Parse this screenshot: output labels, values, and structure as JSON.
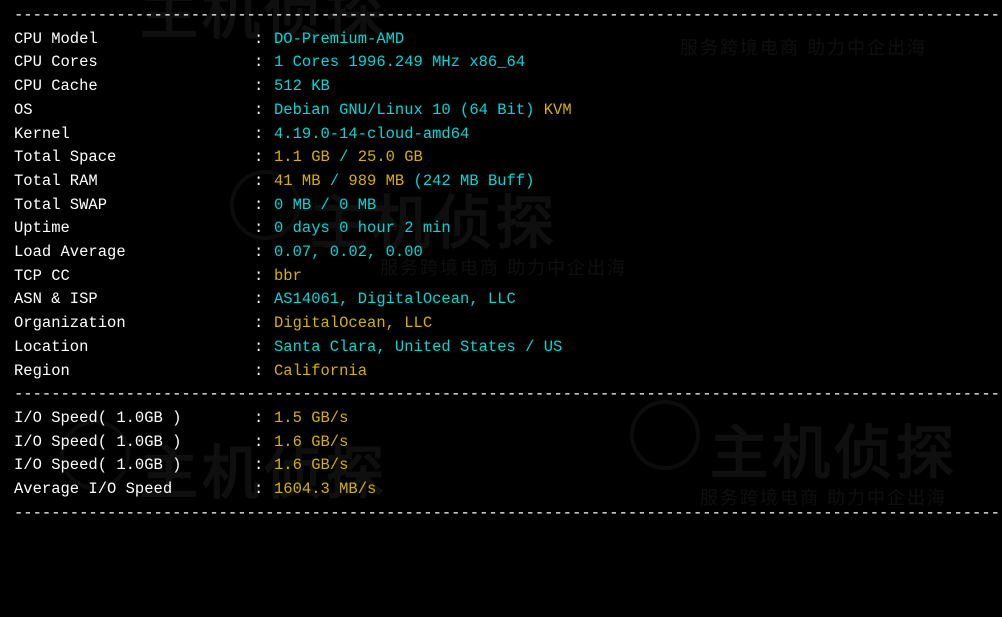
{
  "separator": "----------------------------------------------------------------------------------------------------------",
  "sys": [
    {
      "label": "CPU Model          ",
      "parts": [
        {
          "c": "cyan",
          "t": "DO-Premium-AMD"
        }
      ]
    },
    {
      "label": "CPU Cores          ",
      "parts": [
        {
          "c": "cyan",
          "t": "1 Cores 1996.249 MHz x86_64"
        }
      ]
    },
    {
      "label": "CPU Cache          ",
      "parts": [
        {
          "c": "cyan",
          "t": "512 KB"
        }
      ]
    },
    {
      "label": "OS                 ",
      "parts": [
        {
          "c": "cyan",
          "t": "Debian GNU/Linux 10 (64 Bit) "
        },
        {
          "c": "yellow",
          "t": "KVM"
        }
      ]
    },
    {
      "label": "Kernel             ",
      "parts": [
        {
          "c": "cyan",
          "t": "4.19.0-14-cloud-amd64"
        }
      ]
    },
    {
      "label": "Total Space        ",
      "parts": [
        {
          "c": "yellow",
          "t": "1.1 GB "
        },
        {
          "c": "cyan",
          "t": "/ "
        },
        {
          "c": "yellow",
          "t": "25.0 GB"
        }
      ]
    },
    {
      "label": "Total RAM          ",
      "parts": [
        {
          "c": "yellow",
          "t": "41 MB "
        },
        {
          "c": "cyan",
          "t": "/ "
        },
        {
          "c": "yellow",
          "t": "989 MB "
        },
        {
          "c": "cyan",
          "t": "(242 MB Buff)"
        }
      ]
    },
    {
      "label": "Total SWAP         ",
      "parts": [
        {
          "c": "cyan",
          "t": "0 MB / 0 MB"
        }
      ]
    },
    {
      "label": "Uptime             ",
      "parts": [
        {
          "c": "cyan",
          "t": "0 days 0 hour 2 min"
        }
      ]
    },
    {
      "label": "Load Average       ",
      "parts": [
        {
          "c": "cyan",
          "t": "0.07, 0.02, 0.00"
        }
      ]
    },
    {
      "label": "TCP CC             ",
      "parts": [
        {
          "c": "yellow",
          "t": "bbr"
        }
      ]
    },
    {
      "label": "ASN & ISP          ",
      "parts": [
        {
          "c": "cyan",
          "t": "AS14061, DigitalOcean, LLC"
        }
      ]
    },
    {
      "label": "Organization       ",
      "parts": [
        {
          "c": "yellow",
          "t": "DigitalOcean, LLC"
        }
      ]
    },
    {
      "label": "Location           ",
      "parts": [
        {
          "c": "cyan",
          "t": "Santa Clara, United States / US"
        }
      ]
    },
    {
      "label": "Region             ",
      "parts": [
        {
          "c": "yellow",
          "t": "California"
        }
      ]
    }
  ],
  "io": [
    {
      "label": "I/O Speed( 1.0GB ) ",
      "parts": [
        {
          "c": "yellow",
          "t": "1.5 GB/s"
        }
      ]
    },
    {
      "label": "I/O Speed( 1.0GB ) ",
      "parts": [
        {
          "c": "yellow",
          "t": "1.6 GB/s"
        }
      ]
    },
    {
      "label": "I/O Speed( 1.0GB ) ",
      "parts": [
        {
          "c": "yellow",
          "t": "1.6 GB/s"
        }
      ]
    },
    {
      "label": "Average I/O Speed  ",
      "parts": [
        {
          "c": "yellow",
          "t": "1604.3 MB/s"
        }
      ]
    }
  ]
}
